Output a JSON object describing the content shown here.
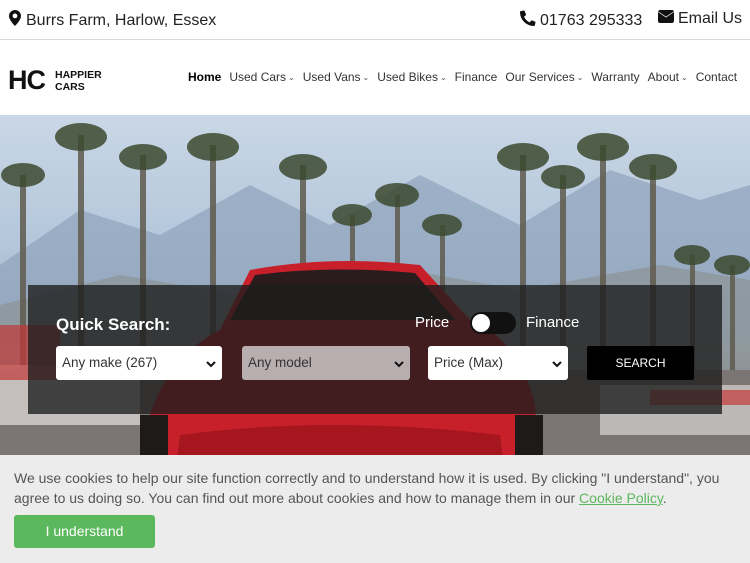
{
  "topbar": {
    "location": "Burrs Farm, Harlow, Essex",
    "phone": "01763 295333",
    "email_label": "Email Us"
  },
  "logo": {
    "mark": "HC",
    "line1": "HAPPIER",
    "line2": "CARS"
  },
  "nav": {
    "items": [
      {
        "label": "Home"
      },
      {
        "label": "Used Cars"
      },
      {
        "label": "Used Vans"
      },
      {
        "label": "Used Bikes"
      },
      {
        "label": "Finance"
      },
      {
        "label": "Our Services"
      },
      {
        "label": "Warranty"
      },
      {
        "label": "About"
      },
      {
        "label": "Contact"
      }
    ],
    "chevron": "⌄"
  },
  "quick_search": {
    "title": "Quick Search:",
    "toggle_left": "Price",
    "toggle_right": "Finance",
    "make_select": "Any make (267)",
    "model_select": "Any model",
    "price_select": "Price (Max)",
    "search_button": "SEARCH"
  },
  "cookie": {
    "text_before": "We use cookies to help our site function correctly and to understand how it is used. By clicking \"I understand\", you agree to us doing so. You can find out more about cookies and how to manage them in our ",
    "link": "Cookie Policy",
    "text_after": ".",
    "button": "I understand"
  },
  "colors": {
    "accent_green": "#5cb85c",
    "car_red": "#d0202a",
    "panel": "#1c1c1c"
  },
  "icons": [
    "map-marker-icon",
    "phone-icon",
    "envelope-icon",
    "chevron-down-icon"
  ]
}
